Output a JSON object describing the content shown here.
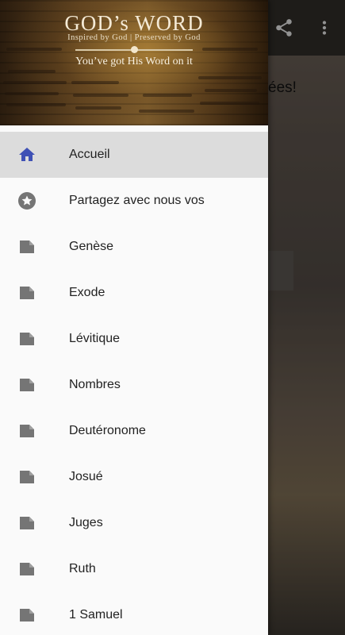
{
  "background_app": {
    "partial_text": "ées!"
  },
  "drawer": {
    "header": {
      "title": "GOD’s WORD",
      "subtitle": "Inspired by God | Preserved by God",
      "tagline": "You’ve got His Word on it"
    },
    "items": [
      {
        "label": "Accueil",
        "icon": "home-icon",
        "active": true
      },
      {
        "label": "Partagez avec nous vos",
        "icon": "star-icon"
      },
      {
        "label": "Genèse",
        "icon": "book-icon"
      },
      {
        "label": "Exode",
        "icon": "book-icon"
      },
      {
        "label": "Lévitique",
        "icon": "book-icon"
      },
      {
        "label": "Nombres",
        "icon": "book-icon"
      },
      {
        "label": "Deutéronome",
        "icon": "book-icon"
      },
      {
        "label": "Josué",
        "icon": "book-icon"
      },
      {
        "label": "Juges",
        "icon": "book-icon"
      },
      {
        "label": "Ruth",
        "icon": "book-icon"
      },
      {
        "label": "1 Samuel",
        "icon": "book-icon"
      }
    ]
  },
  "colors": {
    "active_icon": "#3f51b5",
    "inactive_icon": "#757575",
    "active_row": "#dcdcdc"
  }
}
